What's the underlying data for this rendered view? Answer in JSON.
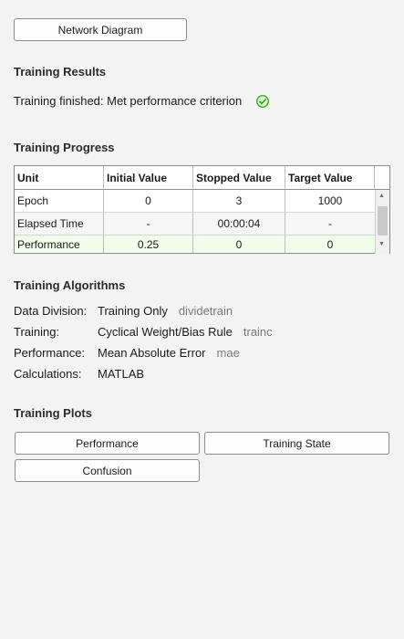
{
  "top_button": "Network Diagram",
  "results": {
    "title": "Training Results",
    "status": "Training finished: Met performance criterion",
    "status_icon": "check-circle-icon",
    "status_color": "#1fa300"
  },
  "progress": {
    "title": "Training Progress",
    "columns": [
      "Unit",
      "Initial Value",
      "Stopped Value",
      "Target Value"
    ],
    "rows": [
      {
        "unit": "Epoch",
        "initial": "0",
        "stopped": "3",
        "target": "1000"
      },
      {
        "unit": "Elapsed Time",
        "initial": "-",
        "stopped": "00:00:04",
        "target": "-"
      },
      {
        "unit": "Performance",
        "initial": "0.25",
        "stopped": "0",
        "target": "0"
      }
    ],
    "highlight_color": "#f0fde8"
  },
  "algorithms": {
    "title": "Training Algorithms",
    "items": [
      {
        "label": "Data Division:",
        "value": "Training Only",
        "fn": "dividetrain"
      },
      {
        "label": "Training:",
        "value": "Cyclical Weight/Bias Rule",
        "fn": "trainc"
      },
      {
        "label": "Performance:",
        "value": "Mean Absolute Error",
        "fn": "mae"
      },
      {
        "label": "Calculations:",
        "value": "MATLAB",
        "fn": ""
      }
    ]
  },
  "plots": {
    "title": "Training Plots",
    "buttons": [
      "Performance",
      "Training State",
      "Confusion"
    ]
  }
}
